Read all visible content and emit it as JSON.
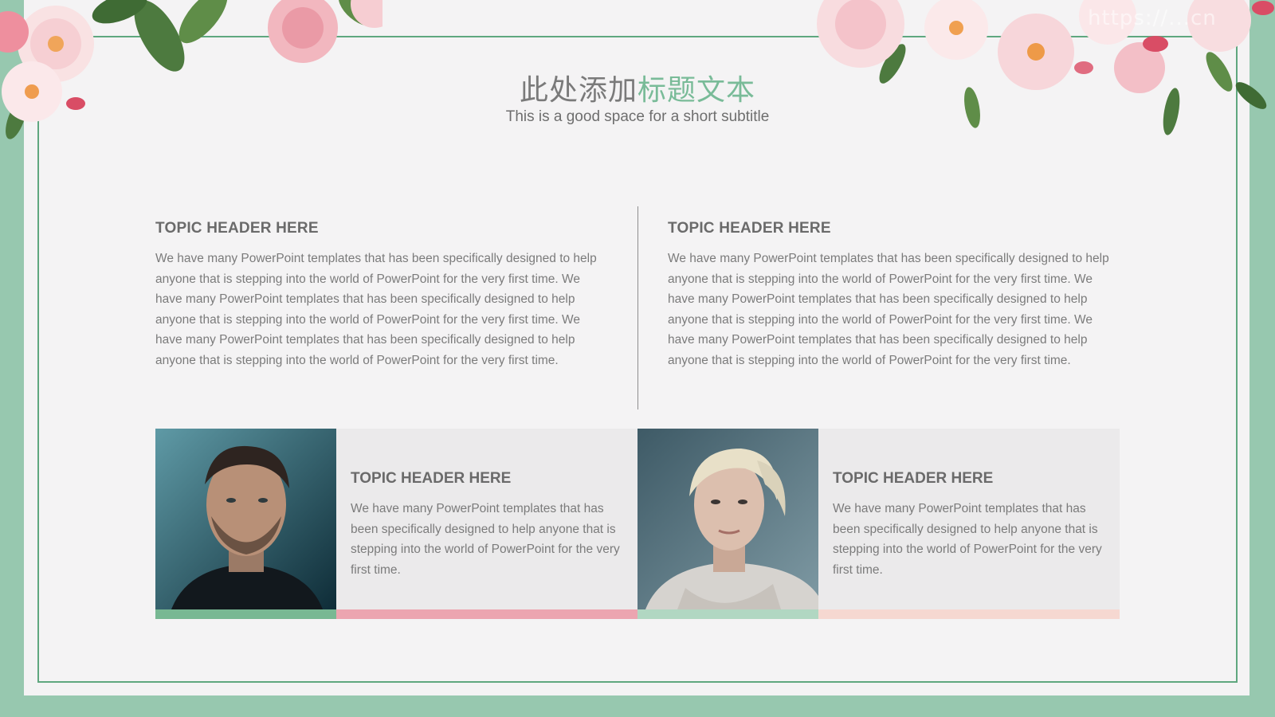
{
  "watermark": "https://...cn",
  "slide": {
    "title_main": "此处添加",
    "title_accent": "标题文本",
    "subtitle": "This is a good space for a short subtitle"
  },
  "topics": [
    {
      "header": "TOPIC HEADER HERE",
      "body": "We have many PowerPoint templates that has been specifically designed to help anyone that is stepping into the world of PowerPoint for the very first time. We have many PowerPoint templates that has been specifically designed to help anyone that is stepping into the world of PowerPoint for the very first time. We have many PowerPoint templates that has been specifically designed to help anyone that is stepping into the world of PowerPoint for the very first time."
    },
    {
      "header": "TOPIC HEADER HERE",
      "body": "We have many PowerPoint templates that has been specifically designed to help anyone that is stepping into the world of PowerPoint for the very first time. We have many PowerPoint templates that has been specifically designed to help anyone that is stepping into the world of PowerPoint for the very first time. We have many PowerPoint templates that has been specifically designed to help anyone that is stepping into the world of PowerPoint for the very first time."
    }
  ],
  "cards": [
    {
      "photo": "man-portrait",
      "header": "TOPIC HEADER HERE",
      "body": "We have many PowerPoint templates that has been specifically designed to help anyone that is stepping into the world of PowerPoint for the very first time."
    },
    {
      "photo": "woman-portrait",
      "header": "TOPIC HEADER HERE",
      "body": "We have many PowerPoint templates that has been specifically designed to help anyone that is stepping into the world of PowerPoint for the very first time."
    }
  ],
  "colors": {
    "background": "#97c8af",
    "frame": "#5fa77f",
    "accent_green": "#79bb98",
    "accent_pink": "#eca5b0",
    "light_green": "#b1d7c2",
    "light_peach": "#f6d8d1"
  }
}
